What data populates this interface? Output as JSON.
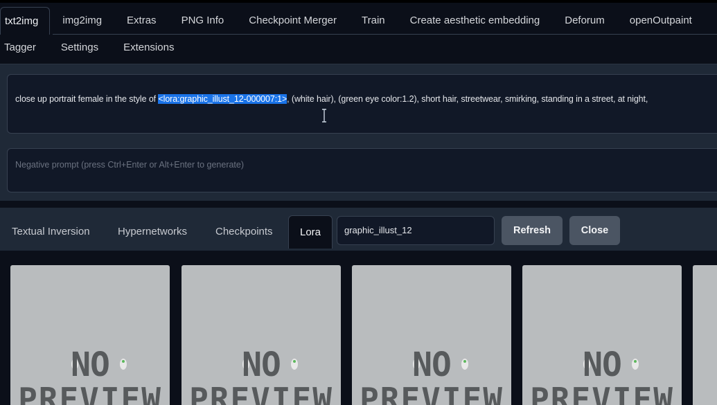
{
  "tabs_row1": [
    "txt2img",
    "img2img",
    "Extras",
    "PNG Info",
    "Checkpoint Merger",
    "Train",
    "Create aesthetic embedding",
    "Deforum",
    "openOutpaint"
  ],
  "tabs_row2": [
    "Tagger",
    "Settings",
    "Extensions"
  ],
  "prompt": {
    "before": "close up portrait female in the style of ",
    "selected": "<lora:graphic_illust_12-000007:1>",
    "after": ", (white hair), (green eye color:1.2), short hair, streetwear, smirking, standing in a street, at night,"
  },
  "negative_prompt": {
    "placeholder": "Negative prompt (press Ctrl+Enter or Alt+Enter to generate)"
  },
  "extra_networks": {
    "tabs": [
      "Textual Inversion",
      "Hypernetworks",
      "Checkpoints",
      "Lora"
    ],
    "active_tab": "Lora",
    "search_value": "graphic_illust_12",
    "refresh_label": "Refresh",
    "close_label": "Close"
  },
  "cards": [
    {
      "line1": "NO",
      "line2": "PREVIEW"
    },
    {
      "line1": "NO",
      "line2": "PREVIEW"
    },
    {
      "line1": "NO",
      "line2": "PREVIEW"
    },
    {
      "line1": "NO",
      "line2": "PREVIEW"
    }
  ],
  "colors": {
    "background": "#0b0f19",
    "panel": "#1f2937",
    "selection": "#1a73e8",
    "button": "#4b5563"
  }
}
